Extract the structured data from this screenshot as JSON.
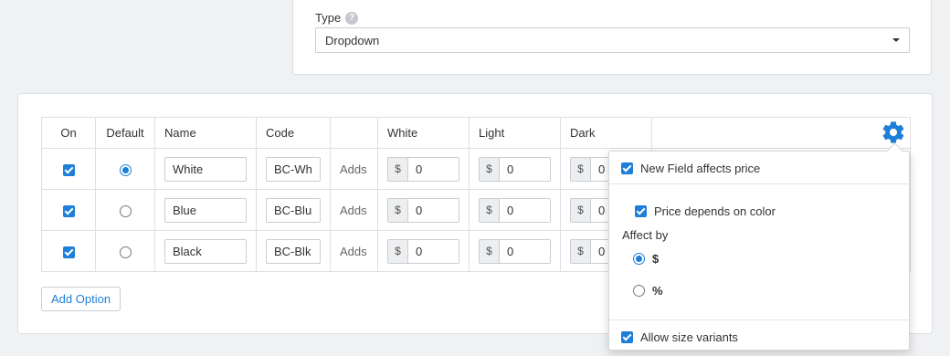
{
  "type_field": {
    "label": "Type",
    "help": "?",
    "value": "Dropdown"
  },
  "table": {
    "headers": {
      "on": "On",
      "default": "Default",
      "name": "Name",
      "code": "Code",
      "white": "White",
      "light": "Light",
      "dark": "Dark"
    },
    "rows": [
      {
        "on": true,
        "default": true,
        "name": "White",
        "code": "BC-Wh",
        "adds": "Adds",
        "unit": "$",
        "white": "0",
        "light": "0",
        "dark": "0"
      },
      {
        "on": true,
        "default": false,
        "name": "Blue",
        "code": "BC-Blu",
        "adds": "Adds",
        "unit": "$",
        "white": "0",
        "light": "0",
        "dark": "0"
      },
      {
        "on": true,
        "default": false,
        "name": "Black",
        "code": "BC-Blk",
        "adds": "Adds",
        "unit": "$",
        "white": "0",
        "light": "0",
        "dark": "0"
      }
    ]
  },
  "add_option_label": "Add Option",
  "settings_popover": {
    "affects_price": {
      "label": "New Field affects price",
      "checked": true
    },
    "depends_on_color": {
      "label": "Price depends on color",
      "checked": true
    },
    "affect_by_label": "Affect by",
    "affect_by_options": [
      {
        "label": "$",
        "selected": true
      },
      {
        "label": "%",
        "selected": false
      }
    ],
    "size_variants": {
      "label": "Allow size variants",
      "checked": true
    }
  },
  "colors": {
    "accent": "#1e7fd8"
  },
  "icons": {
    "settings": "gear-icon",
    "help": "help-icon",
    "dropdown": "caret-down-icon"
  }
}
